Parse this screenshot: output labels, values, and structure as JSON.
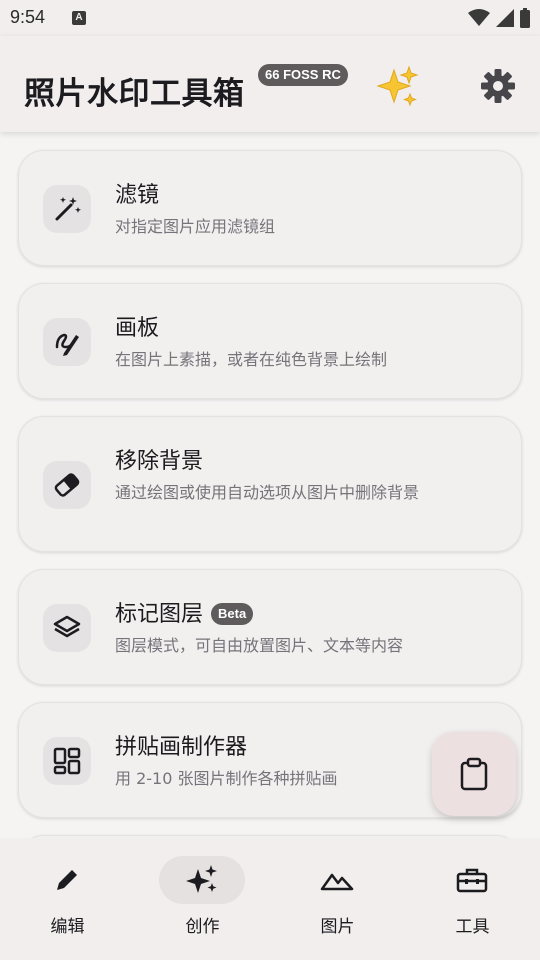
{
  "status_bar": {
    "time": "9:54",
    "notification_icon": "A"
  },
  "app_bar": {
    "title": "照片水印工具箱",
    "version_badge": "66 FOSS RC",
    "decor_icon": "sparkles-emoji",
    "settings_icon": "gear-icon"
  },
  "cards": [
    {
      "icon": "magic-wand-icon",
      "title": "滤镜",
      "description": "对指定图片应用滤镜组"
    },
    {
      "icon": "draw-icon",
      "title": "画板",
      "description": "在图片上素描，或者在纯色背景上绘制"
    },
    {
      "icon": "eraser-icon",
      "title": "移除背景",
      "description": "通过绘图或使用自动选项从图片中删除背景"
    },
    {
      "icon": "layers-icon",
      "title": "标记图层",
      "badge": "Beta",
      "description": "图层模式，可自由放置图片、文本等内容"
    },
    {
      "icon": "collage-icon",
      "title": "拼贴画制作器",
      "description": "用 2-10 张图片制作各种拼贴画"
    }
  ],
  "fab": {
    "icon": "clipboard-icon"
  },
  "bottom_nav": [
    {
      "icon": "pencil-icon",
      "label": "编辑",
      "active": false
    },
    {
      "icon": "sparkles-icon",
      "label": "创作",
      "active": true
    },
    {
      "icon": "mountains-icon",
      "label": "图片",
      "active": false
    },
    {
      "icon": "toolbox-icon",
      "label": "工具",
      "active": false
    }
  ]
}
